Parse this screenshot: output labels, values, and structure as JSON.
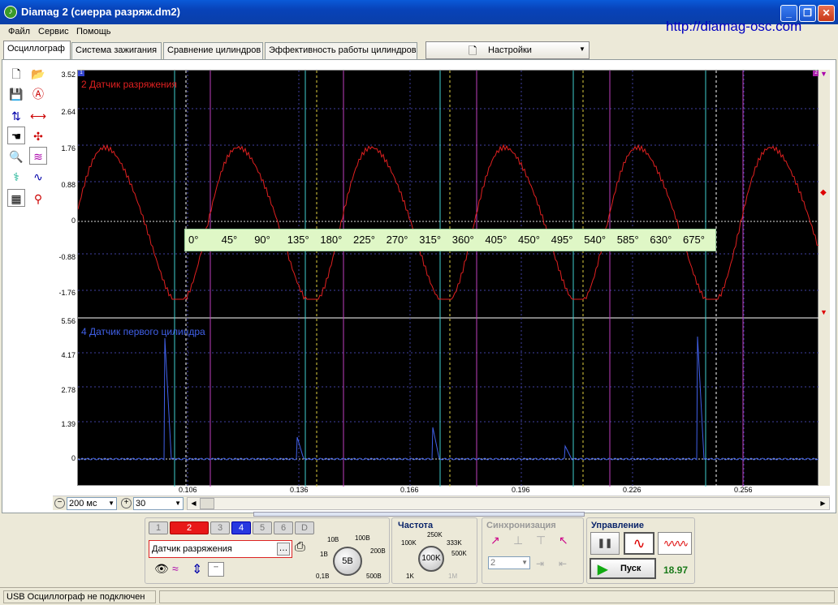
{
  "window": {
    "title": "Diamag 2 (сиерра разряж.dm2)",
    "controls": [
      "_",
      "❐",
      "✕"
    ]
  },
  "menu": [
    "Файл",
    "Сервис",
    "Помощь"
  ],
  "url": "http://diamag-osc.com",
  "tabs": [
    {
      "label": "Осциллограф",
      "active": true
    },
    {
      "label": "Система зажигания",
      "active": false
    },
    {
      "label": "Сравнение цилиндров",
      "active": false
    },
    {
      "label": "Эффективность работы цилиндров",
      "active": false
    }
  ],
  "settings_label": "Настройки",
  "channels": {
    "top": {
      "label": "2 Датчик разряжения",
      "color": "#E02020",
      "yticks": [
        "3.52",
        "2.64",
        "1.76",
        "0.88",
        "0",
        "-0.88",
        "-1.76"
      ]
    },
    "bottom": {
      "label": "4 Датчик первого цилиндра",
      "color": "#4060E8",
      "yticks": [
        "5.56",
        "4.17",
        "2.78",
        "1.39",
        "0"
      ]
    }
  },
  "marker_top_left": "1",
  "marker_top_right": "2",
  "angle_scale": [
    "0°",
    "45°",
    "90°",
    "135°",
    "180°",
    "225°",
    "270°",
    "315°",
    "360°",
    "405°",
    "450°",
    "495°",
    "540°",
    "585°",
    "630°",
    "675°"
  ],
  "xticks": [
    "0.106",
    "0.136",
    "0.166",
    "0.196",
    "0.226",
    "0.256"
  ],
  "timebase": {
    "value": "200",
    "unit": "мс",
    "zoom": "30"
  },
  "channel_buttons": [
    {
      "label": "1",
      "state": "off"
    },
    {
      "label": "2",
      "state": "red"
    },
    {
      "label": "3",
      "state": "off"
    },
    {
      "label": "4",
      "state": "blue"
    },
    {
      "label": "5",
      "state": "off"
    },
    {
      "label": "6",
      "state": "off"
    },
    {
      "label": "D",
      "state": "off"
    }
  ],
  "sensor_name": "Датчик разряжения",
  "voltage": {
    "value": "5В",
    "scale": [
      "1В",
      "10В",
      "100В",
      "200В",
      "500В",
      "0,1В"
    ]
  },
  "frequency": {
    "title": "Частота",
    "value": "100K",
    "scale": [
      "250K",
      "100K",
      "333K",
      "500K",
      "1K",
      "1M"
    ]
  },
  "sync": {
    "title": "Синхронизация",
    "channel": "2"
  },
  "control": {
    "title": "Управление",
    "start_label": "Пуск",
    "readout": "18.97"
  },
  "status": "USB Осциллограф не подключен"
}
